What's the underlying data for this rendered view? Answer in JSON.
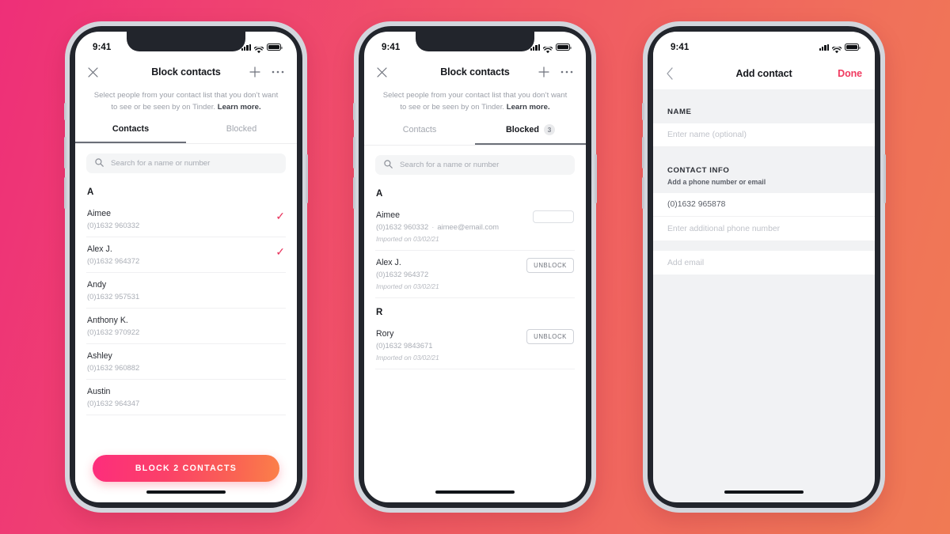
{
  "theme": {
    "background_gradient_from": "#ee2f78",
    "background_gradient_to": "#f07a54",
    "accent": "#f03a5f",
    "cta_gradient_from": "#fd2d7c",
    "cta_gradient_to": "#fb8049"
  },
  "status_bar": {
    "time": "9:41"
  },
  "phone1": {
    "nav": {
      "close_label": "×",
      "title": "Block contacts",
      "add_label": "+",
      "more_label": "···"
    },
    "subtitle": {
      "text": "Select people from your contact list that you don’t want to see or be seen by on Tinder. ",
      "link": "Learn more."
    },
    "tabs": [
      {
        "label": "Contacts",
        "active": true,
        "badge": ""
      },
      {
        "label": "Blocked",
        "active": false,
        "badge": ""
      }
    ],
    "search": {
      "placeholder": "Search for a name or number"
    },
    "sections": [
      {
        "letter": "A",
        "rows": [
          {
            "name": "Aimee",
            "phone": "(0)1632 960332",
            "selected": true
          },
          {
            "name": "Alex J.",
            "phone": "(0)1632 964372",
            "selected": true
          },
          {
            "name": "Andy",
            "phone": "(0)1632 957531",
            "selected": false
          },
          {
            "name": "Anthony K.",
            "phone": "(0)1632 970922",
            "selected": false
          },
          {
            "name": "Ashley",
            "phone": "(0)1632 960882",
            "selected": false
          },
          {
            "name": "Austin",
            "phone": "(0)1632 964347",
            "selected": false
          }
        ]
      }
    ],
    "cta_label": "BLOCK 2 CONTACTS",
    "check_glyph": "✓"
  },
  "phone2": {
    "nav": {
      "close_label": "×",
      "title": "Block contacts",
      "add_label": "+",
      "more_label": "···"
    },
    "subtitle": {
      "text": "Select people from your contact list that you don’t want to see or be seen by on Tinder. ",
      "link": "Learn more."
    },
    "tabs": [
      {
        "label": "Contacts",
        "active": false,
        "badge": ""
      },
      {
        "label": "Blocked",
        "active": true,
        "badge": "3"
      }
    ],
    "search": {
      "placeholder": "Search for a name or number"
    },
    "unblock_label": "UNBLOCK",
    "sections": [
      {
        "letter": "A",
        "rows": [
          {
            "name": "Aimee",
            "phone": "(0)1632 960332",
            "separator": "·",
            "email": "aimee@email.com",
            "imported": "Imported on 03/02/21",
            "state": "loading"
          },
          {
            "name": "Alex J.",
            "phone": "(0)1632 964372",
            "separator": "",
            "email": "",
            "imported": "Imported on 03/02/21",
            "state": "blocked"
          }
        ]
      },
      {
        "letter": "R",
        "rows": [
          {
            "name": "Rory",
            "phone": "(0)1632 9843671",
            "separator": "",
            "email": "",
            "imported": "Imported on 03/02/21",
            "state": "blocked"
          }
        ]
      }
    ]
  },
  "phone3": {
    "nav": {
      "back_label": "‹",
      "title": "Add contact",
      "done_label": "Done"
    },
    "name_section": {
      "header": "NAME",
      "field_placeholder": "Enter name (optional)"
    },
    "contact_section": {
      "header": "CONTACT INFO",
      "subheader": "Add a phone number or email",
      "phone_value": "(0)1632 965878",
      "additional_phone_placeholder": "Enter additional phone number",
      "email_placeholder": "Add email"
    }
  }
}
